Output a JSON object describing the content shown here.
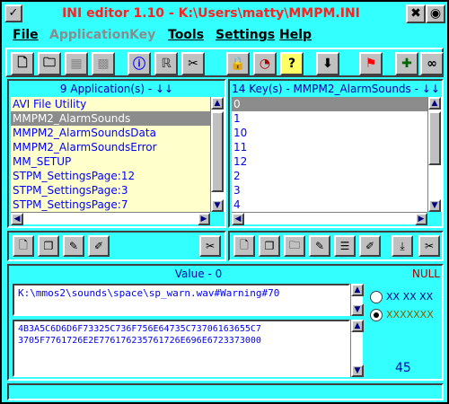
{
  "window": {
    "title": "INI editor 1.10 - K:\\Users\\matty\\MMPM.INI"
  },
  "menu": [
    {
      "label": "File",
      "enabled": true
    },
    {
      "label": "Application",
      "enabled": false
    },
    {
      "label": "Key",
      "enabled": false
    },
    {
      "label": "Tools",
      "enabled": true
    },
    {
      "label": "Settings",
      "enabled": true
    },
    {
      "label": "Help",
      "enabled": true
    }
  ],
  "toolbar_icons": [
    "new-file-icon",
    "open-folder-icon",
    "save-icon",
    "save-as-icon",
    "info-icon",
    "help-icon",
    "cut-icon",
    "lock-icon",
    "timer-icon",
    "question-icon",
    "download-icon",
    "flag-icon",
    "add-icon",
    "binoculars-icon"
  ],
  "applications": {
    "header": "9 Application(s) - ↓↓",
    "items": [
      "AVI File Utility",
      "MMPM2_AlarmSounds",
      "MMPM2_AlarmSoundsData",
      "MMPM2_AlarmSoundsError",
      "MM_SETUP",
      "STPM_SettingsPage:12",
      "STPM_SettingsPage:3",
      "STPM_SettingsPage:7"
    ],
    "selected_index": 1
  },
  "keys": {
    "header": "14 Key(s) - MMPM2_AlarmSounds - ↓↓",
    "items": [
      "0",
      "1",
      "10",
      "11",
      "12",
      "2",
      "3",
      "4"
    ],
    "selected_index": 0
  },
  "value": {
    "header": "Value - 0",
    "null_label": "NULL",
    "text": "K:\\mmos2\\sounds\\space\\sp_warn.wav#Warning#70",
    "hex_line1": "4B3A5C6D6D6F73325C736F756E64735C73706163655C7",
    "hex_line2": "3705F7761726E2E776176235761726E696E6723373000",
    "length": "45",
    "radio_hex_label": "XX XX XX",
    "radio_x_label": "XXXXXXX",
    "radio_selected": "x"
  }
}
